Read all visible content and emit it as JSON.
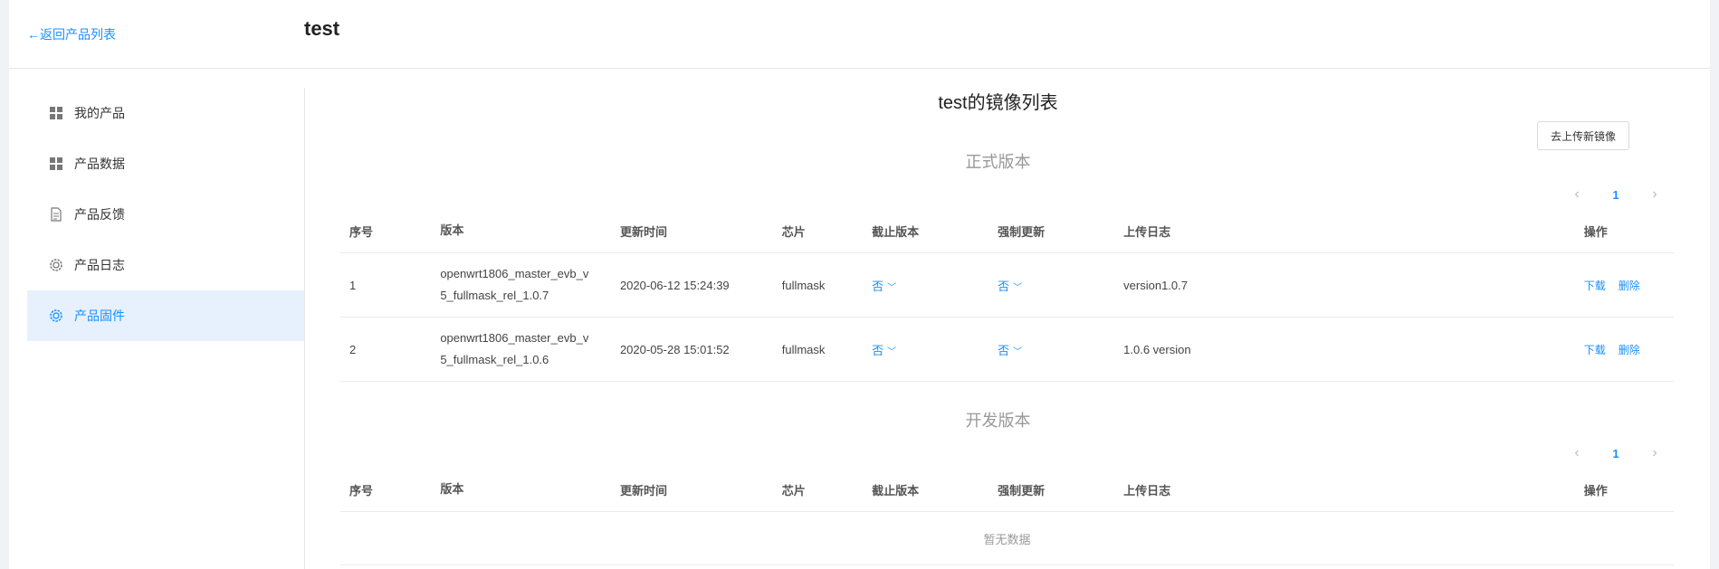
{
  "header": {
    "back_label": "←返回产品列表",
    "product_title": "test"
  },
  "sidebar": {
    "items": [
      {
        "label": "我的产品",
        "icon": "grid-icon"
      },
      {
        "label": "产品数据",
        "icon": "grid-icon"
      },
      {
        "label": "产品反馈",
        "icon": "document-icon"
      },
      {
        "label": "产品日志",
        "icon": "gear-icon"
      },
      {
        "label": "产品固件",
        "icon": "gear-icon",
        "active": true
      }
    ]
  },
  "main": {
    "list_title": "test的镜像列表",
    "upload_button": "去上传新镜像",
    "columns": [
      "序号",
      "版本",
      "更新时间",
      "芯片",
      "截止版本",
      "强制更新",
      "上传日志",
      "操作"
    ],
    "release": {
      "title": "正式版本",
      "page": "1",
      "rows": [
        {
          "index": "1",
          "version_line1": "openwrt1806_master_evb_v",
          "version_line2": "5_fullmask_rel_1.0.7",
          "updated": "2020-06-12 15:24:39",
          "chip": "fullmask",
          "cutoff": "否",
          "force": "否",
          "log": "version1.0.7",
          "download": "下载",
          "delete": "删除"
        },
        {
          "index": "2",
          "version_line1": "openwrt1806_master_evb_v",
          "version_line2": "5_fullmask_rel_1.0.6",
          "updated": "2020-05-28 15:01:52",
          "chip": "fullmask",
          "cutoff": "否",
          "force": "否",
          "log": "1.0.6 version",
          "download": "下载",
          "delete": "删除"
        }
      ]
    },
    "dev": {
      "title": "开发版本",
      "page": "1",
      "empty": "暂无数据"
    }
  },
  "colors": {
    "accent": "#1890ff",
    "active_bg": "#e6f1fd"
  }
}
